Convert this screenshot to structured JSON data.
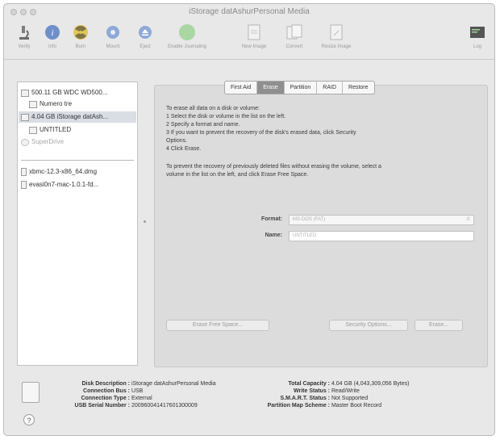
{
  "window": {
    "title": "iStorage datAshurPersonal Media"
  },
  "toolbar": {
    "verify": "Verify",
    "info": "Info",
    "burn": "Burn",
    "mount": "Mount",
    "eject": "Eject",
    "enable_journaling": "Enable Journaling",
    "new_image": "New Image",
    "convert": "Convert",
    "resize_image": "Resize Image",
    "log": "Log"
  },
  "sidebar": {
    "items": [
      {
        "label": "500.11 GB WDC WD500..."
      },
      {
        "label": "Numero tre"
      },
      {
        "label": "4.04 GB iStorage datAsh..."
      },
      {
        "label": "UNTITLED"
      },
      {
        "label": "SuperDrive"
      },
      {
        "label": "xbmc-12.3-x86_64.dmg"
      },
      {
        "label": "evasi0n7-mac-1.0.1-fd..."
      }
    ]
  },
  "tabs": [
    "First Aid",
    "Erase",
    "Partition",
    "RAID",
    "Restore"
  ],
  "erase": {
    "intro": "To erase all data on a disk or volume:",
    "step1": "1    Select the disk or volume in the list on the left.",
    "step2": "2    Specify a format and name.",
    "step3a": "3    If you want to prevent the recovery of the disk's erased data, click Security",
    "step3b": "Options.",
    "step4": "4    Click Erase.",
    "prevent_a": "To prevent the recovery of previously deleted files without erasing the volume, select a",
    "prevent_b": "volume in the list on the left, and click Erase Free Space.",
    "format_label": "Format:",
    "format_value": "MS-DOS (FAT)",
    "name_label": "Name:",
    "name_value": "UNTITLED",
    "erase_free_space": "Erase Free Space...",
    "security_options": "Security Options...",
    "erase_button": "Erase..."
  },
  "info": {
    "disk_description_label": "Disk Description :",
    "disk_description": "iStorage datAshurPersonal Media",
    "connection_bus_label": "Connection Bus :",
    "connection_bus": "USB",
    "connection_type_label": "Connection Type :",
    "connection_type": "External",
    "usb_serial_label": "USB Serial Number :",
    "usb_serial": "200960041417601300009",
    "total_capacity_label": "Total Capacity :",
    "total_capacity": "4.04 GB (4,043,309,056 Bytes)",
    "write_status_label": "Write Status :",
    "write_status": "Read/Write",
    "smart_label": "S.M.A.R.T. Status :",
    "smart": "Not Supported",
    "partition_map_label": "Partition Map Scheme :",
    "partition_map": "Master Boot Record"
  },
  "help": "?"
}
